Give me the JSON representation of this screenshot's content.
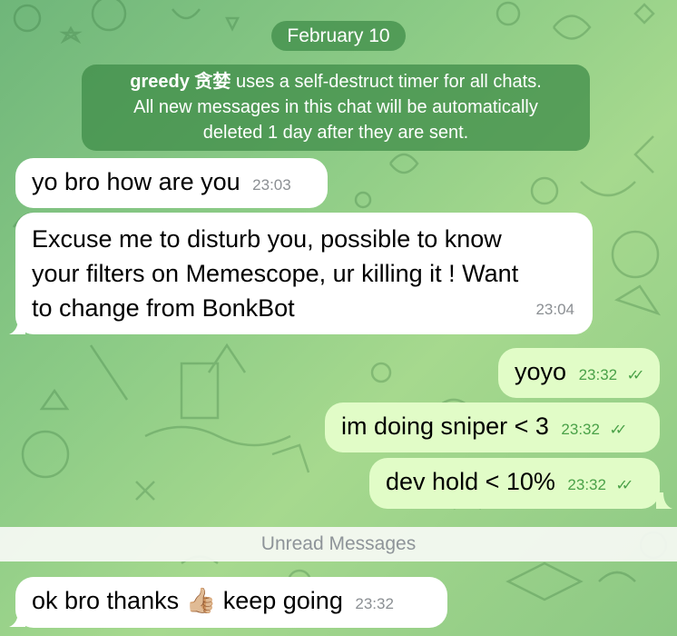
{
  "chat": {
    "date_label": "February 10",
    "service_message": {
      "sender": "greedy 贪婪",
      "text_line1": " uses a self-destruct timer for all chats.",
      "text_line2": "All new messages in this chat will be automatically",
      "text_line3": "deleted 1 day after they are sent."
    },
    "messages": [
      {
        "direction": "in",
        "text": "yo bro how are you",
        "time": "23:03"
      },
      {
        "direction": "in",
        "text_line1": "Excuse me to disturb you, possible to know",
        "text_line2": "your filters on Memescope, ur killing it ! Want",
        "text_line3": "to change from BonkBot",
        "time": "23:04"
      },
      {
        "direction": "out",
        "text": "yoyo",
        "time": "23:32",
        "status": "read"
      },
      {
        "direction": "out",
        "text": "im doing sniper < 3",
        "time": "23:32",
        "status": "read"
      },
      {
        "direction": "out",
        "text": "dev hold < 10%",
        "time": "23:32",
        "status": "read"
      },
      {
        "direction": "in",
        "text_before": "ok bro thanks ",
        "emoji": "👍🏼",
        "text_after": " keep going",
        "time": "23:32"
      }
    ],
    "unread_divider": "Unread Messages"
  },
  "colors": {
    "background_start": "#6fb67a",
    "background_end": "#a6d98e",
    "incoming_bubble": "#ffffff",
    "outgoing_bubble": "#e1fcc7",
    "outgoing_time": "#4aa148",
    "service_pill": "#3f8c48"
  },
  "icons": {
    "read_status": "double-check-icon",
    "wallpaper": "doodle-pattern"
  }
}
